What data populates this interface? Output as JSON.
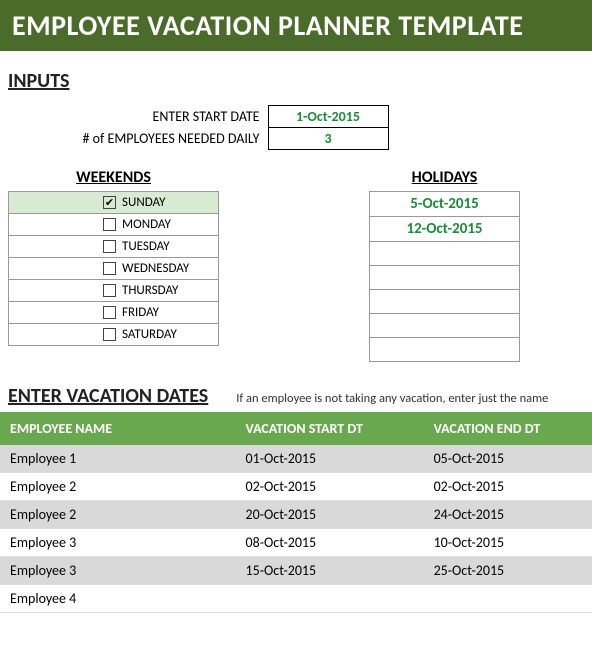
{
  "title": "EMPLOYEE VACATION PLANNER TEMPLATE",
  "inputs_header": "INPUTS",
  "start_date_label": "ENTER START DATE",
  "start_date_value": "1-Oct-2015",
  "employees_needed_label": "# of EMPLOYEES NEEDED DAILY",
  "employees_needed_value": "3",
  "weekends_header": "WEEKENDS",
  "holidays_header": "HOLIDAYS",
  "weekends": [
    {
      "label": "SUNDAY",
      "checked": true
    },
    {
      "label": "MONDAY",
      "checked": false
    },
    {
      "label": "TUESDAY",
      "checked": false
    },
    {
      "label": "WEDNESDAY",
      "checked": false
    },
    {
      "label": "THURSDAY",
      "checked": false
    },
    {
      "label": "FRIDAY",
      "checked": false
    },
    {
      "label": "SATURDAY",
      "checked": false
    }
  ],
  "holidays": [
    "5-Oct-2015",
    "12-Oct-2015",
    "",
    "",
    "",
    "",
    ""
  ],
  "enter_dates_header": "ENTER VACATION DATES",
  "hint": "If an employee is not taking any vacation, enter just the name",
  "vac_headers": {
    "name": "EMPLOYEE NAME",
    "start": "VACATION START DT",
    "end": "VACATION END DT"
  },
  "vacations": [
    {
      "name": "Employee 1",
      "start": "01-Oct-2015",
      "end": "05-Oct-2015"
    },
    {
      "name": "Employee 2",
      "start": "02-Oct-2015",
      "end": "02-Oct-2015"
    },
    {
      "name": "Employee 2",
      "start": "20-Oct-2015",
      "end": "24-Oct-2015"
    },
    {
      "name": "Employee 3",
      "start": "08-Oct-2015",
      "end": "10-Oct-2015"
    },
    {
      "name": "Employee 3",
      "start": "15-Oct-2015",
      "end": "25-Oct-2015"
    },
    {
      "name": "Employee 4",
      "start": "",
      "end": ""
    }
  ]
}
